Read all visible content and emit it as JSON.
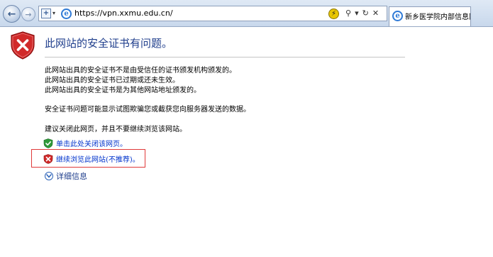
{
  "toolbar": {
    "back_symbol": "←",
    "forward_symbol": "→",
    "address_mode_symbol": "+",
    "address_mode_dropdown": "▾",
    "url": "https://vpn.xxmu.edu.cn/",
    "search_symbol": "⚲",
    "dropdown_symbol": "▾",
    "refresh_symbol": "↻",
    "stop_symbol": "✕"
  },
  "tab": {
    "title": "新乡医学院内部信息网"
  },
  "page": {
    "heading": "此网站的安全证书有问题。",
    "reasons": [
      "此网站出具的安全证书不是由受信任的证书颁发机构颁发的。",
      "此网站出具的安全证书已过期或还未生效。",
      "此网站出具的安全证书是为其他网站地址颁发的。"
    ],
    "warning": "安全证书问题可能显示试图欺骗您或截获您向服务器发送的数据。",
    "advice": "建议关闭此网页，并且不要继续浏览该网站。",
    "close_link": "单击此处关闭该网页。",
    "continue_link": "继续浏览此网站(不推荐)。",
    "more_info": "详细信息"
  },
  "icons": {
    "error_shield": "shield-x-icon",
    "safe_shield": "shield-check-icon",
    "danger_shield": "shield-x-small-icon",
    "expand": "chevron-down-circle-icon"
  },
  "colors": {
    "heading": "#1f3e8c",
    "link": "#0033cc",
    "highlight_border": "#e03a3a",
    "error_red": "#d12a2a",
    "safe_green": "#2f9a3a"
  }
}
